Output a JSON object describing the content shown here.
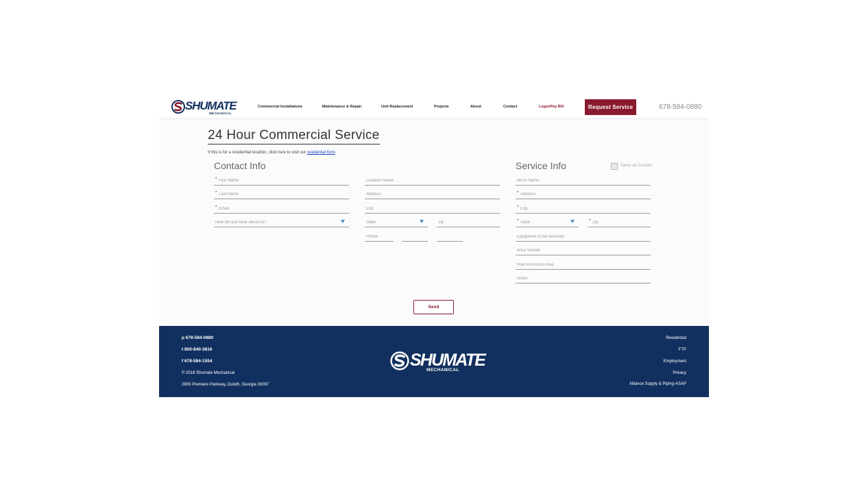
{
  "brand": {
    "name": "SHUMATE",
    "sub": "MECHANICAL",
    "navy": "#12305f",
    "red": "#8a1a2e"
  },
  "nav": {
    "items": [
      "Commercial Installations",
      "Maintenance & Repair",
      "Unit Replacement",
      "Projects",
      "About",
      "Contact"
    ],
    "login": "Login/Pay Bill",
    "request_label": "Request Service",
    "phone": "678-584-0880"
  },
  "page": {
    "title": "24 Hour Commercial Service",
    "intro": "If this is for a residential location, click here to visit our",
    "intro_link": "residential form",
    "intro_end": "."
  },
  "contact": {
    "title": "Contact Info",
    "first_name": "First Name",
    "last_name": "Last Name",
    "email": "Email",
    "hear": "How did you hear about us?"
  },
  "location": {
    "name": "Location Name",
    "address": "Address",
    "city": "City",
    "state": "State",
    "zip": "Zip",
    "phone": "Phone"
  },
  "service": {
    "title": "Service Info",
    "same_as": "Same as Contact",
    "bill_to": "Bill to Name",
    "address": "Address",
    "city": "City",
    "state": "State",
    "zip": "Zip",
    "equipment": "Equipment to be Serviced",
    "area": "Area Served",
    "access": "How to Access Area",
    "notes": "Notes"
  },
  "form": {
    "required_mark": "*",
    "send_label": "Send"
  },
  "footer": {
    "phone": "p 678-584-0880",
    "tollfree": "t 800-840-3816",
    "fax": "f 678-584-1554",
    "copyright": "© 2018 Shumate Mechanical",
    "address": "2805 Premiere Parkway, Duluth, Georgia 30097",
    "links": [
      "Residential",
      "FTP",
      "Employment",
      "Privacy",
      "Alliance Supply & Piping-ASAP"
    ]
  }
}
